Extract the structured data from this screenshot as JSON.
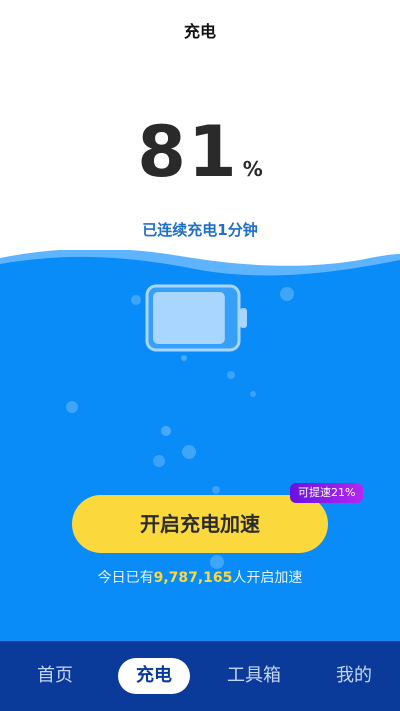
{
  "header": {
    "title": "充电"
  },
  "battery_status": {
    "level_percent": 81,
    "percent_value": "81",
    "percent_unit": "%",
    "duration_text": "已连续充电1分钟"
  },
  "accelerate": {
    "button_label": "开启充电加速",
    "badge_label": "可提速21%"
  },
  "today": {
    "prefix": "今日已有",
    "count": "9,787,165",
    "suffix": "人开启加速"
  },
  "tabs": [
    {
      "label": "首页",
      "active": false
    },
    {
      "label": "充电",
      "active": true
    },
    {
      "label": "工具箱",
      "active": false
    },
    {
      "label": "我的",
      "active": false
    }
  ],
  "colors": {
    "water_back": "#5fb4ff",
    "water_main": "#0a8cf8",
    "accent_yellow": "#fbd93c",
    "tabbar": "#0a3a9a",
    "badge_purple": "#8a1ce8"
  }
}
